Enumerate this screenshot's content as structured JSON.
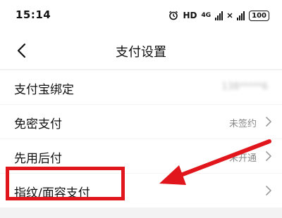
{
  "status_bar": {
    "time": "15:14",
    "hd_label": "HD",
    "network_label": "4G",
    "battery": "100"
  },
  "nav": {
    "title": "支付设置",
    "back_icon": "chevron-left-icon"
  },
  "settings": [
    {
      "label": "支付宝绑定",
      "value": "138*****6",
      "value_blurred": true
    },
    {
      "label": "免密支付",
      "value": "未签约"
    },
    {
      "label": "先用后付",
      "value": "未开通"
    },
    {
      "label": "指纹/面容支付",
      "value": ""
    }
  ],
  "colors": {
    "annotation_red": "#e0161c",
    "value_gray": "#888888",
    "background": "#f3f3f3"
  }
}
